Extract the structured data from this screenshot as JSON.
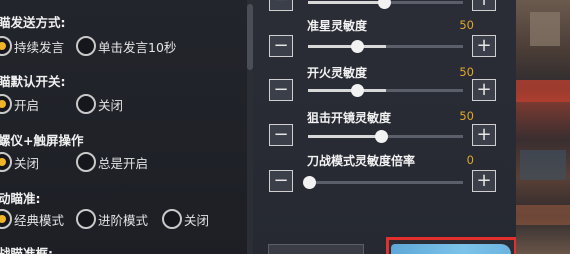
{
  "left": {
    "sections": [
      {
        "title": "瞄发送方式:",
        "options": [
          {
            "label": "持续发言",
            "selected": true
          },
          {
            "label": "单击发言10秒",
            "selected": false
          }
        ]
      },
      {
        "title": "瞄默认开关:",
        "options": [
          {
            "label": "开启",
            "selected": true
          },
          {
            "label": "关闭",
            "selected": false
          }
        ]
      },
      {
        "title": "螺仪+触屏操作",
        "options": [
          {
            "label": "关闭",
            "selected": true
          },
          {
            "label": "总是开启",
            "selected": false
          }
        ]
      },
      {
        "title": "动瞄准:",
        "options": [
          {
            "label": "经典模式",
            "selected": true
          },
          {
            "label": "进阶模式",
            "selected": false
          },
          {
            "label": "关闭",
            "selected": false
          }
        ]
      },
      {
        "title": "战瞄准框:",
        "options": []
      }
    ]
  },
  "sliders": [
    {
      "label": "准星灵敏度",
      "value": "50",
      "fraction": 0.5
    },
    {
      "label": "开火灵敏度",
      "value": "50",
      "fraction": 0.5
    },
    {
      "label": "狙击开镜灵敏度",
      "value": "50",
      "fraction": 0.5
    },
    {
      "label": "刀战模式灵敏度倍率",
      "value": "0",
      "fraction": 0.0
    }
  ],
  "icons": {
    "minus": "−",
    "plus": "+"
  },
  "colors": {
    "accent_value": "#e0a82a",
    "highlight_frame": "#e3302d",
    "confirm_button": "#6bb5e0",
    "radio_selected": "#f0b429"
  }
}
